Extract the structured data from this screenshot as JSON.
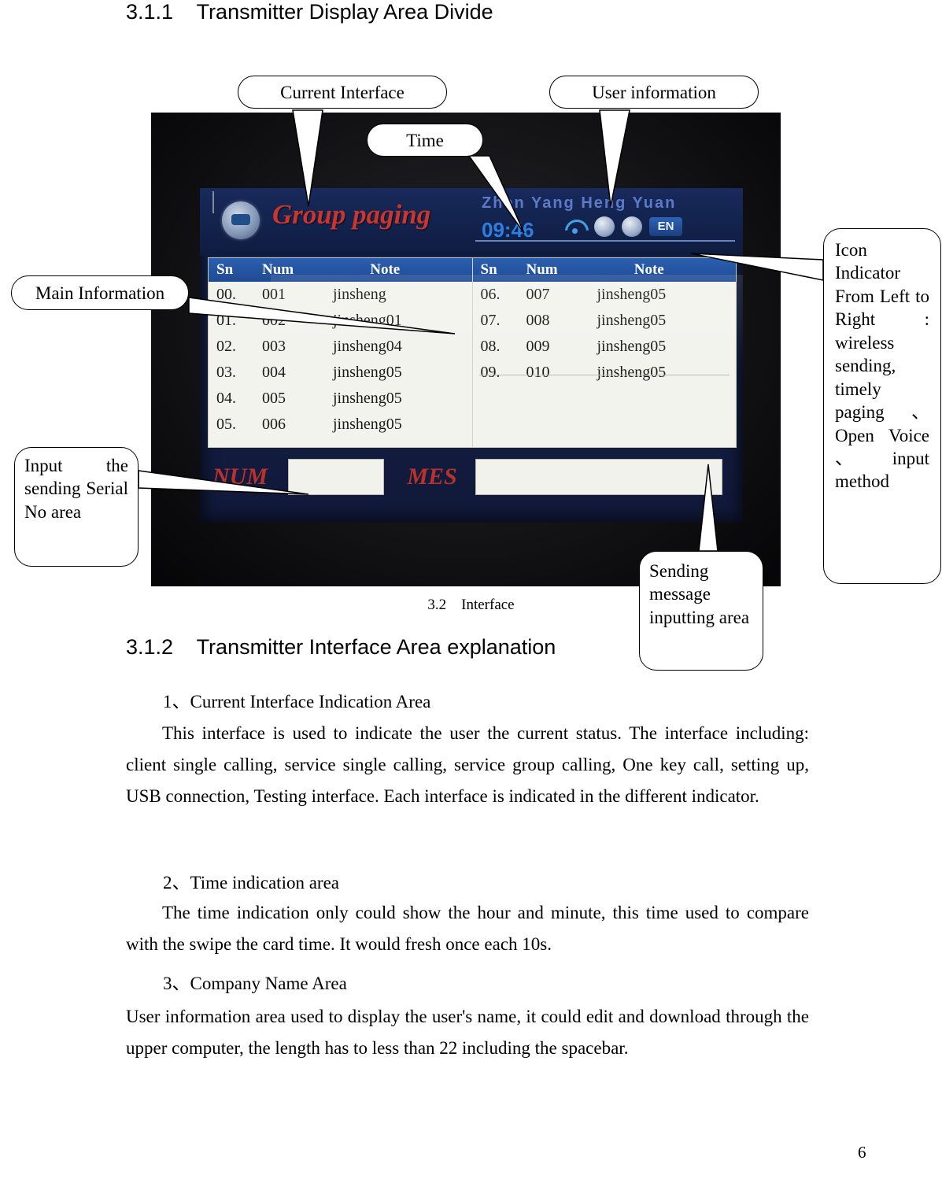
{
  "headings": {
    "s311": "3.1.1    Transmitter Display Area Divide",
    "s312": "3.1.2    Transmitter Interface Area explanation"
  },
  "figure": {
    "caption": "3.2    Interface"
  },
  "callouts": {
    "current_interface": "Current Interface",
    "user_information": "User information",
    "time": "Time",
    "main_information": "Main Information",
    "input_serial": "Input the sending Serial No area",
    "icon_indicator": "Icon Indicator From Left to Right : wireless sending, timely paging 、Open Voice 、input method",
    "sending_message": "Sending message inputting area"
  },
  "device": {
    "title": "Group paging",
    "user": "Zhen Yang Heng Yuan",
    "time": "09:46",
    "ime": "EN",
    "icons": [
      "wifi-icon",
      "clock-icon",
      "voice-icon",
      "ime-badge"
    ],
    "columns": [
      "Sn",
      "Num",
      "Note"
    ],
    "left_rows": [
      {
        "sn": "00.",
        "num": "001",
        "note": "jinsheng"
      },
      {
        "sn": "01.",
        "num": "002",
        "note": "jinsheng01"
      },
      {
        "sn": "02.",
        "num": "003",
        "note": "jinsheng04"
      },
      {
        "sn": "03.",
        "num": "004",
        "note": "jinsheng05"
      },
      {
        "sn": "04.",
        "num": "005",
        "note": "jinsheng05"
      },
      {
        "sn": "05.",
        "num": "006",
        "note": "jinsheng05"
      }
    ],
    "right_rows": [
      {
        "sn": "06.",
        "num": "007",
        "note": "jinsheng05"
      },
      {
        "sn": "07.",
        "num": "008",
        "note": "jinsheng05"
      },
      {
        "sn": "08.",
        "num": "009",
        "note": "jinsheng05"
      },
      {
        "sn": "09.",
        "num": "010",
        "note": "jinsheng05"
      },
      {
        "sn": "",
        "num": "",
        "note": ""
      },
      {
        "sn": "",
        "num": "",
        "note": ""
      }
    ],
    "num_label": "NUM",
    "mes_label": "MES",
    "num_value": "",
    "mes_value": ""
  },
  "content": {
    "item1": "1、Current Interface Indication Area",
    "para1": "This interface is used to indicate the user the current status. The interface including: client single calling, service single calling, service group calling, One key call, setting up, USB connection, Testing interface. Each interface is indicated in the different indicator.",
    "item2": "2、Time indication area",
    "para2": "The time indication only could show the hour and minute, this time used to compare with the swipe the card time. It would fresh once each 10s.",
    "item3": "3、Company Name Area",
    "para3": "User information area used to display the user's name, it could edit and download through the upper computer, the length has to less than 22 including the spacebar."
  },
  "page_number": "6"
}
